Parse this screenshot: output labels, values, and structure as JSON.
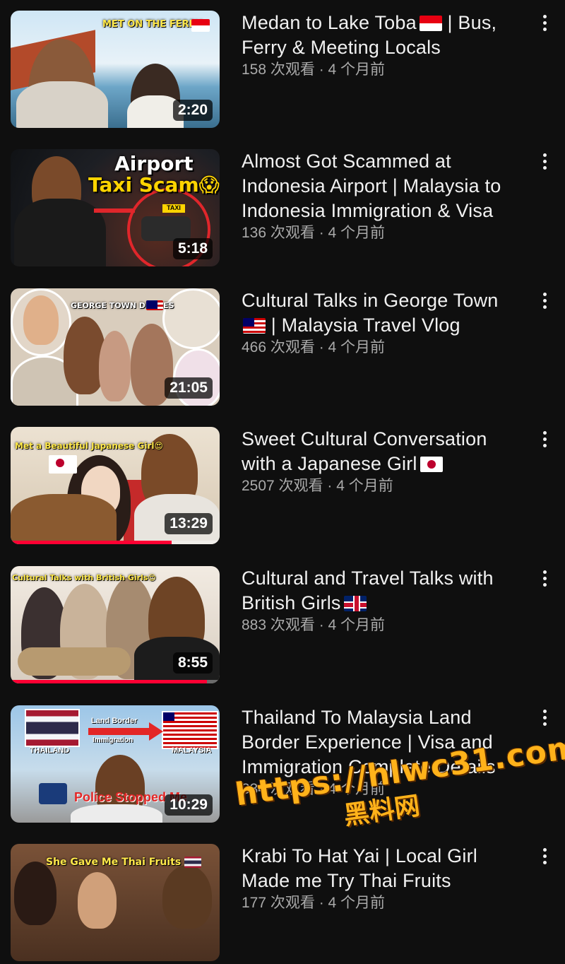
{
  "videos": [
    {
      "title": "Medan to Lake Toba",
      "title_suffix": " | Bus, Ferry & Meeting Locals",
      "title_flag": "flag-indonesia",
      "stats": "158 次观看 · 4 个月前",
      "duration": "2:20",
      "thumb_text": "MET ON THE FERRY",
      "thumb_flag": "flag-indonesia",
      "colors": {
        "sky": "#cfe6f5",
        "accent": "#3b9acb"
      }
    },
    {
      "title": "Almost Got Scammed at Indonesia Airport | Malaysia to Indonesia Immigration & Visa",
      "title_suffix": "",
      "stats": "136 次观看 · 4 个月前",
      "duration": "5:18",
      "thumb_line1": "Airport",
      "thumb_line2": "Taxi Scam😱",
      "thumb_sign": "TAXI",
      "colors": {
        "sky": "#1a1d22",
        "accent": "#e0262b"
      }
    },
    {
      "title": "Cultural Talks in George Town",
      "title_suffix": " | Malaysia Travel Vlog",
      "title_flag": "flag-malaysia",
      "title_flag_first": true,
      "stats": "466 次观看 · 4 个月前",
      "duration": "21:05",
      "thumb_text": "GEORGE TOWN DIARIES",
      "thumb_flag": "flag-malaysia",
      "colors": {
        "sky": "#e9e1d6",
        "accent": "#c69a6a"
      }
    },
    {
      "title": "Sweet Cultural Conversation with a Japanese Girl",
      "title_suffix": "",
      "title_flag": "flag-japan",
      "stats": "2507 次观看 · 4 个月前",
      "duration": "13:29",
      "watched_fraction": 0.77,
      "thumb_text": "Met a Beautiful Japanese Girl😍",
      "thumb_flag": "flag-japan",
      "colors": {
        "sky": "#e6d9c7",
        "accent": "#c52a2a"
      }
    },
    {
      "title": "Cultural and Travel Talks with British Girls",
      "title_suffix": "",
      "title_flag": "flag-uk",
      "stats": "883 次观看 · 4 个月前",
      "duration": "8:55",
      "watched_fraction": 0.94,
      "thumb_text": "Cultural Talks with British Girls😍",
      "colors": {
        "sky": "#efe7de",
        "accent": "#7a6f68"
      }
    },
    {
      "title": "Thailand To Malaysia Land Border Experience | Visa and Immigration Complete Details",
      "title_suffix": "",
      "stats": "334 次观看 · 4 个月前",
      "duration": "10:29",
      "thumb_left_label": "THAILAND",
      "thumb_right_label": "MALAYSIA",
      "thumb_arrow_label_1": "Land Border",
      "thumb_arrow_label_2": "Immigration",
      "thumb_bottom": "Police Stopped Me",
      "colors": {
        "sky": "#9cc6e8",
        "accent": "#e32626"
      }
    },
    {
      "title": "Krabi To Hat Yai | Local Girl Made me Try Thai Fruits",
      "title_suffix": "",
      "stats": "177 次观看 · 4 个月前",
      "thumb_text": "She Gave Me Thai Fruits",
      "thumb_flag": "flag-thailand",
      "colors": {
        "sky": "#6b4a36",
        "accent": "#c89b5c"
      }
    }
  ],
  "watermark": {
    "url": "https://hlwc31.com",
    "cn": "黑料网"
  }
}
